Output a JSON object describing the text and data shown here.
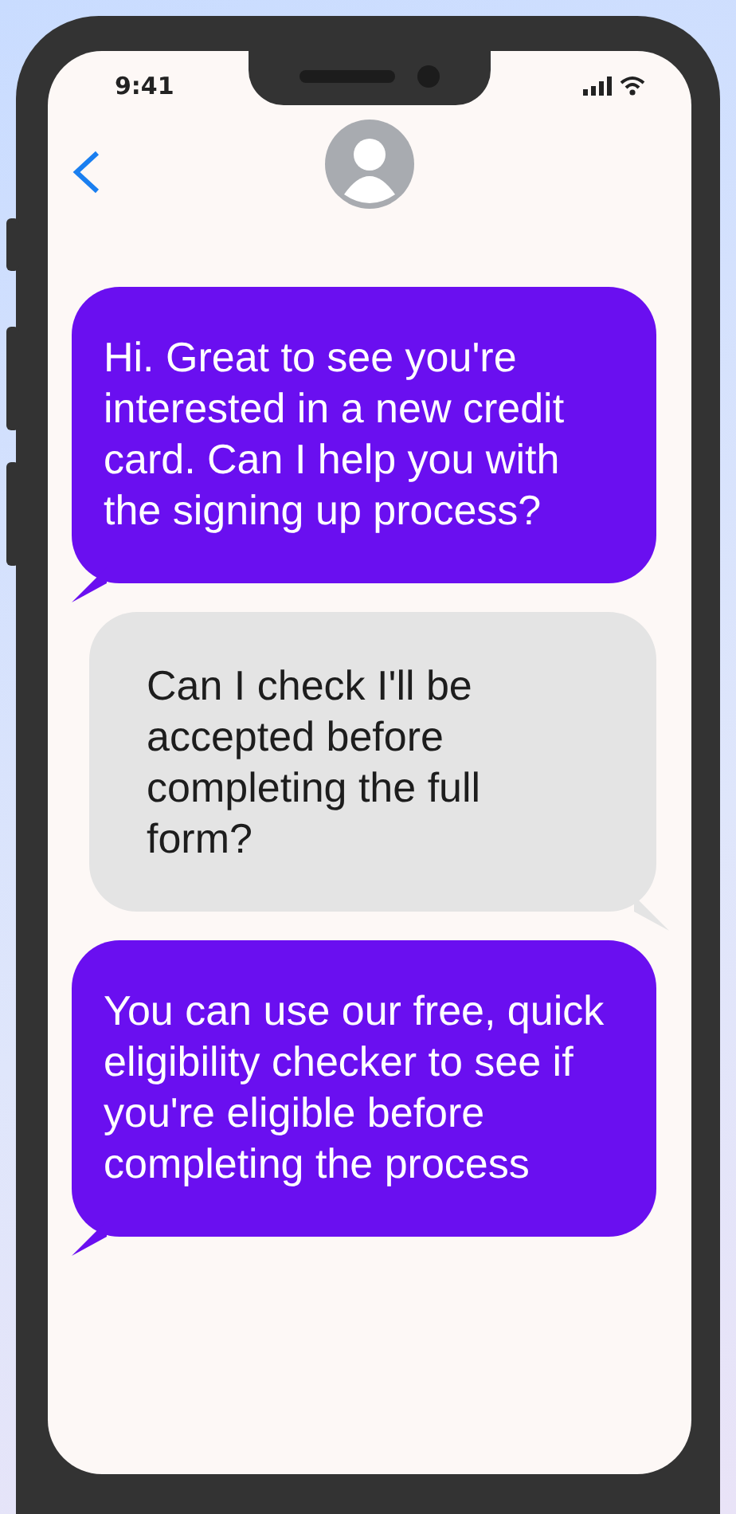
{
  "status_bar": {
    "time": "9:41"
  },
  "messages": [
    {
      "kind": "received",
      "text": "Hi. Great to see you're interested in a new credit card. Can I help you with the signing up process?"
    },
    {
      "kind": "sent",
      "text": "Can I check I'll be accepted before completing the full form?"
    },
    {
      "kind": "received",
      "text": "You can use our free, quick eligibility checker to see if you're eligible before completing the process"
    }
  ]
}
